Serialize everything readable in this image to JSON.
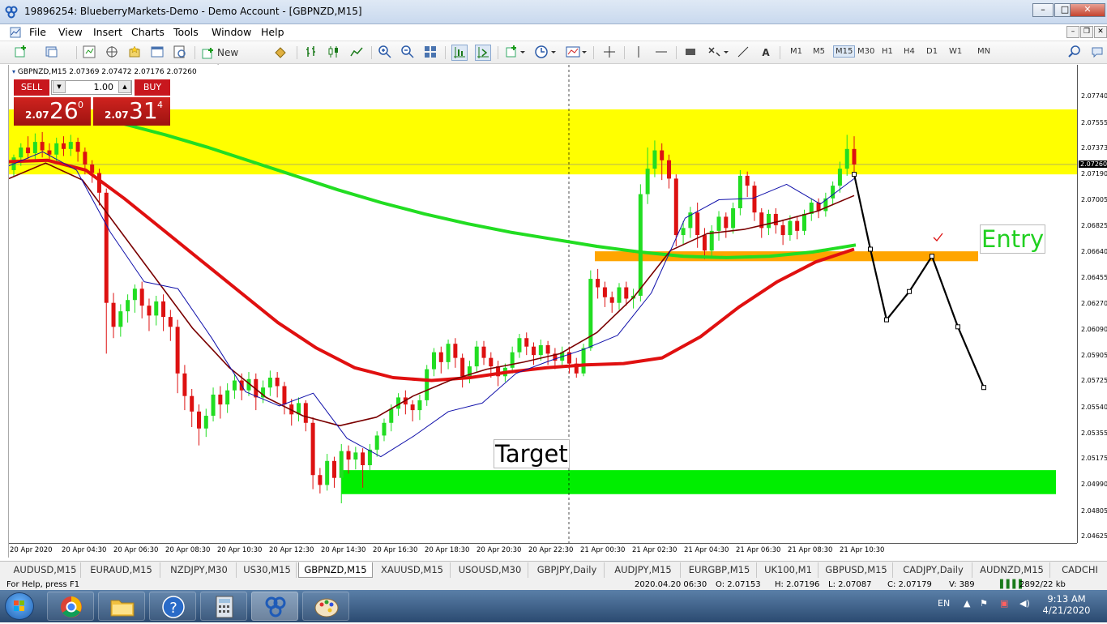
{
  "window": {
    "title": "19896254: BlueberryMarkets-Demo - Demo Account - [GBPNZD,M15]",
    "controls": [
      "–",
      "□",
      "✕"
    ]
  },
  "menu": [
    "File",
    "View",
    "Insert",
    "Charts",
    "Tools",
    "Window",
    "Help"
  ],
  "toolbar": {
    "new_order": "New Order",
    "timeframes": [
      "M1",
      "M5",
      "M15",
      "M30",
      "H1",
      "H4",
      "D1",
      "W1",
      "MN"
    ],
    "active_timeframe": "M15"
  },
  "chart": {
    "header": "GBPNZD,M15  2.07369 2.07472 2.07176 2.07260",
    "one_click": {
      "sell": "SELL",
      "buy": "BUY",
      "lot": "1.00",
      "bid_prefix": "2.07",
      "bid_big": "26",
      "bid_sup": "0",
      "ask_prefix": "2.07",
      "ask_big": "31",
      "ask_sup": "4"
    },
    "price_labels": [
      "2.07740",
      "2.07555",
      "2.07373",
      "2.07190",
      "2.07005",
      "2.06825",
      "2.06640",
      "2.06455",
      "2.06270",
      "2.06090",
      "2.05905",
      "2.05725",
      "2.05540",
      "2.05355",
      "2.05175",
      "2.04990",
      "2.04805",
      "2.04625"
    ],
    "current_price": "2.07260",
    "time_labels": [
      "20 Apr 2020",
      "20 Apr 04:30",
      "20 Apr 06:30",
      "20 Apr 08:30",
      "20 Apr 10:30",
      "20 Apr 12:30",
      "20 Apr 14:30",
      "20 Apr 16:30",
      "20 Apr 18:30",
      "20 Apr 20:30",
      "20 Apr 22:30",
      "21 Apr 00:30",
      "21 Apr 02:30",
      "21 Apr 04:30",
      "21 Apr 06:30",
      "21 Apr 08:30",
      "21 Apr 10:30"
    ],
    "target_label": "Target",
    "entry_label": "Entry",
    "colors": {
      "resistance_zone": "#ffff00",
      "target_zone": "#00ee00",
      "entry_zone": "#ffa500",
      "bull": "#22dd22",
      "bear": "#dd1111",
      "ma_slow": "#22dd22",
      "ma_mid": "#e01010",
      "ma_fast": "#7a0000",
      "ma_fastest": "#1010aa"
    },
    "chart_data": {
      "type": "candlestick",
      "symbol": "GBPNZD",
      "timeframe": "M15",
      "ylim": [
        2.04625,
        2.0792
      ],
      "open": 2.07369,
      "high": 2.07472,
      "low": 2.07176,
      "close": 2.0726,
      "zones": [
        {
          "name": "resistance",
          "from": 2.0719,
          "to": 2.0765
        },
        {
          "name": "target",
          "from": 2.04925,
          "to": 2.05095
        },
        {
          "name": "entry",
          "from": 2.06575,
          "to": 2.06645
        }
      ],
      "ma_slow": [
        2.0755,
        2.0747,
        2.0738,
        2.0728,
        2.0718,
        2.0708,
        2.0699,
        2.0691,
        2.0684,
        2.0678,
        2.0673,
        2.0668,
        2.0664,
        2.0661,
        2.066,
        2.0661,
        2.0664,
        2.0669
      ],
      "ma_mid": [
        2.0728,
        2.0729,
        2.0722,
        2.0702,
        2.068,
        2.0658,
        2.0636,
        2.0614,
        2.0596,
        2.0582,
        2.0575,
        2.0573,
        2.0575,
        2.0579,
        2.0582,
        2.0584,
        2.0585,
        2.0589,
        2.0604,
        2.0625,
        2.0643,
        2.0657,
        2.0666
      ],
      "ma_fast": [
        2.0716,
        2.0727,
        2.0715,
        2.068,
        2.0645,
        2.061,
        2.0582,
        2.0561,
        2.0548,
        2.0541,
        2.0547,
        2.0562,
        2.0573,
        2.0581,
        2.0586,
        2.0592,
        2.0607,
        2.0632,
        2.0665,
        2.0677,
        2.068,
        2.0686,
        2.0693,
        2.0704
      ],
      "ma_fastest": [
        2.0725,
        2.0735,
        2.0722,
        2.0678,
        2.0643,
        2.0638,
        2.0603,
        2.0565,
        2.0555,
        2.0564,
        2.0532,
        2.0519,
        2.0534,
        2.0551,
        2.0557,
        2.0578,
        2.0587,
        2.0595,
        2.0605,
        2.0635,
        2.0688,
        2.0701,
        2.0702,
        2.0712,
        2.0698,
        2.0716
      ],
      "forecast": [
        2.0719,
        2.0666,
        2.0616,
        2.0636,
        2.0661,
        2.0611,
        2.0568
      ],
      "candles": [
        [
          2.0722,
          2.0731,
          2.0717,
          2.0733
        ],
        [
          2.0731,
          2.0738,
          2.0725,
          2.0741
        ],
        [
          2.0738,
          2.0734,
          2.073,
          2.0746
        ],
        [
          2.0734,
          2.0742,
          2.0729,
          2.0748
        ],
        [
          2.0742,
          2.0736,
          2.0731,
          2.0749
        ],
        [
          2.0736,
          2.0733,
          2.0728,
          2.0741
        ],
        [
          2.0733,
          2.0741,
          2.0728,
          2.0745
        ],
        [
          2.0741,
          2.0737,
          2.0732,
          2.0746
        ],
        [
          2.0737,
          2.0742,
          2.0732,
          2.0747
        ],
        [
          2.0742,
          2.0735,
          2.0728,
          2.0745
        ],
        [
          2.0735,
          2.0726,
          2.0719,
          2.0738
        ],
        [
          2.0726,
          2.072,
          2.0713,
          2.0729
        ],
        [
          2.072,
          2.0706,
          2.0697,
          2.0723
        ],
        [
          2.0706,
          2.0628,
          2.0592,
          2.0709
        ],
        [
          2.0628,
          2.0611,
          2.0603,
          2.0635
        ],
        [
          2.0611,
          2.0622,
          2.0604,
          2.0627
        ],
        [
          2.0622,
          2.063,
          2.0614,
          2.0634
        ],
        [
          2.063,
          2.0638,
          2.0621,
          2.0641
        ],
        [
          2.0638,
          2.0626,
          2.0617,
          2.0643
        ],
        [
          2.0626,
          2.0619,
          2.0608,
          2.0631
        ],
        [
          2.0619,
          2.0629,
          2.0612,
          2.0633
        ],
        [
          2.0629,
          2.0618,
          2.0608,
          2.0634
        ],
        [
          2.0618,
          2.0611,
          2.0601,
          2.0623
        ],
        [
          2.0611,
          2.0578,
          2.0564,
          2.0616
        ],
        [
          2.0578,
          2.0562,
          2.0552,
          2.0584
        ],
        [
          2.0562,
          2.0551,
          2.054,
          2.0567
        ],
        [
          2.0551,
          2.0539,
          2.0527,
          2.0556
        ],
        [
          2.0539,
          2.0548,
          2.0533,
          2.0553
        ],
        [
          2.0548,
          2.0563,
          2.0544,
          2.0568
        ],
        [
          2.0563,
          2.0556,
          2.0546,
          2.0569
        ],
        [
          2.0556,
          2.0566,
          2.055,
          2.0571
        ],
        [
          2.0566,
          2.0573,
          2.056,
          2.0578
        ],
        [
          2.0573,
          2.0566,
          2.0559,
          2.0578
        ],
        [
          2.0566,
          2.0574,
          2.0562,
          2.0579
        ],
        [
          2.0574,
          2.0561,
          2.0552,
          2.0578
        ],
        [
          2.0561,
          2.0568,
          2.0557,
          2.0573
        ],
        [
          2.0568,
          2.0575,
          2.0562,
          2.058
        ],
        [
          2.0575,
          2.0569,
          2.0561,
          2.0579
        ],
        [
          2.0569,
          2.0556,
          2.0549,
          2.0572
        ],
        [
          2.0556,
          2.0549,
          2.0541,
          2.056
        ],
        [
          2.0549,
          2.0557,
          2.0544,
          2.0561
        ],
        [
          2.0557,
          2.0543,
          2.0537,
          2.0559
        ],
        [
          2.0543,
          2.0506,
          2.0496,
          2.0547
        ],
        [
          2.0506,
          2.0499,
          2.0493,
          2.0511
        ],
        [
          2.0499,
          2.0516,
          2.0495,
          2.0521
        ],
        [
          2.0516,
          2.0504,
          2.0497,
          2.0519
        ],
        [
          2.0504,
          2.0523,
          2.0486,
          2.0528
        ],
        [
          2.0523,
          2.0517,
          2.0507,
          2.0527
        ],
        [
          2.0517,
          2.0522,
          2.051,
          2.0526
        ],
        [
          2.0522,
          2.0513,
          2.0497,
          2.0525
        ],
        [
          2.0513,
          2.0524,
          2.0509,
          2.0528
        ],
        [
          2.0524,
          2.0534,
          2.0519,
          2.0537
        ],
        [
          2.0534,
          2.0543,
          2.053,
          2.0546
        ],
        [
          2.0543,
          2.0553,
          2.0537,
          2.0556
        ],
        [
          2.0553,
          2.0561,
          2.0548,
          2.0564
        ],
        [
          2.0561,
          2.0556,
          2.0549,
          2.0566
        ],
        [
          2.0556,
          2.0552,
          2.0544,
          2.0559
        ],
        [
          2.0552,
          2.0559,
          2.0545,
          2.0563
        ],
        [
          2.0559,
          2.0581,
          2.0555,
          2.0584
        ],
        [
          2.0581,
          2.0593,
          2.0576,
          2.0596
        ],
        [
          2.0593,
          2.0586,
          2.0578,
          2.0597
        ],
        [
          2.0586,
          2.0599,
          2.0581,
          2.0602
        ],
        [
          2.0599,
          2.0589,
          2.0582,
          2.0603
        ],
        [
          2.0589,
          2.0576,
          2.0568,
          2.0592
        ],
        [
          2.0576,
          2.0583,
          2.0571,
          2.0587
        ],
        [
          2.0583,
          2.0597,
          2.0579,
          2.0601
        ],
        [
          2.0597,
          2.0589,
          2.0584,
          2.0601
        ],
        [
          2.0589,
          2.0583,
          2.0575,
          2.0593
        ],
        [
          2.0583,
          2.0576,
          2.0569,
          2.0587
        ],
        [
          2.0576,
          2.0582,
          2.0572,
          2.0585
        ],
        [
          2.0582,
          2.0593,
          2.0578,
          2.0597
        ],
        [
          2.0593,
          2.0603,
          2.0589,
          2.0606
        ],
        [
          2.0603,
          2.0597,
          2.0591,
          2.0607
        ],
        [
          2.0597,
          2.0591,
          2.0584,
          2.06
        ],
        [
          2.0591,
          2.0598,
          2.0587,
          2.0602
        ],
        [
          2.0598,
          2.0592,
          2.0584,
          2.0601
        ],
        [
          2.0592,
          2.0587,
          2.0581,
          2.0596
        ],
        [
          2.0587,
          2.0593,
          2.0582,
          2.0597
        ],
        [
          2.0593,
          2.0585,
          2.0578,
          2.0597
        ],
        [
          2.0585,
          2.0578,
          2.0575,
          2.0589
        ],
        [
          2.0578,
          2.0596,
          2.0576,
          2.0599
        ],
        [
          2.0596,
          2.0645,
          2.0594,
          2.0651
        ],
        [
          2.0645,
          2.0639,
          2.0631,
          2.0652
        ],
        [
          2.0639,
          2.0632,
          2.0625,
          2.0643
        ],
        [
          2.0632,
          2.0628,
          2.0621,
          2.0636
        ],
        [
          2.0628,
          2.0639,
          2.0623,
          2.0642
        ],
        [
          2.0639,
          2.0631,
          2.0626,
          2.0643
        ],
        [
          2.0631,
          2.0633,
          2.0624,
          2.0638
        ],
        [
          2.0633,
          2.0705,
          2.0629,
          2.0712
        ],
        [
          2.0705,
          2.0723,
          2.0698,
          2.0738
        ],
        [
          2.0723,
          2.0736,
          2.0717,
          2.0743
        ],
        [
          2.0736,
          2.0729,
          2.0715,
          2.0741
        ],
        [
          2.0729,
          2.0716,
          2.0709,
          2.0733
        ],
        [
          2.0716,
          2.0676,
          2.0668,
          2.0719
        ],
        [
          2.0676,
          2.0681,
          2.0669,
          2.0686
        ],
        [
          2.0681,
          2.0692,
          2.0674,
          2.0696
        ],
        [
          2.0692,
          2.0676,
          2.0667,
          2.0699
        ],
        [
          2.0676,
          2.0665,
          2.0659,
          2.0681
        ],
        [
          2.0665,
          2.0679,
          2.0661,
          2.0683
        ],
        [
          2.0679,
          2.0689,
          2.0672,
          2.0693
        ],
        [
          2.0689,
          2.0681,
          2.0674,
          2.0692
        ],
        [
          2.0681,
          2.0695,
          2.0677,
          2.0699
        ],
        [
          2.0695,
          2.0718,
          2.069,
          2.0722
        ],
        [
          2.0718,
          2.0711,
          2.0703,
          2.0721
        ],
        [
          2.0711,
          2.0692,
          2.0686,
          2.0714
        ],
        [
          2.0692,
          2.0681,
          2.0674,
          2.0695
        ],
        [
          2.0681,
          2.0691,
          2.0676,
          2.0694
        ],
        [
          2.0691,
          2.0683,
          2.0677,
          2.0695
        ],
        [
          2.0683,
          2.0676,
          2.0669,
          2.0687
        ],
        [
          2.0676,
          2.0686,
          2.0672,
          2.069
        ],
        [
          2.0686,
          2.0679,
          2.0673,
          2.0689
        ],
        [
          2.0679,
          2.0691,
          2.0676,
          2.0694
        ],
        [
          2.0691,
          2.0699,
          2.0686,
          2.0702
        ],
        [
          2.0699,
          2.0693,
          2.0688,
          2.0702
        ],
        [
          2.0693,
          2.0702,
          2.0689,
          2.0706
        ],
        [
          2.0702,
          2.0711,
          2.0697,
          2.0714
        ],
        [
          2.0711,
          2.0723,
          2.0706,
          2.0728
        ],
        [
          2.0723,
          2.0737,
          2.0718,
          2.0747
        ],
        [
          2.0737,
          2.0726,
          2.0717,
          2.0746
        ]
      ]
    }
  },
  "tabs": [
    "AUDUSD,M15",
    "EURAUD,M15",
    "NZDJPY,M30",
    "US30,M15",
    "GBPNZD,M15",
    "XAUUSD,M15",
    "USOUSD,M30",
    "GBPJPY,Daily",
    "AUDJPY,M15",
    "EURGBP,M15",
    "UK100,M1",
    "GBPUSD,M15",
    "CADJPY,Daily",
    "AUDNZD,M15",
    "CADCHI"
  ],
  "active_tab": "GBPNZD,M15",
  "status": {
    "help": "For Help, press F1",
    "datetime": "2020.04.20 06:30",
    "open": "O: 2.07153",
    "high": "H: 2.07196",
    "low": "L: 2.07087",
    "close": "C: 2.07179",
    "volume": "V: 389",
    "traffic": "2892/22 kb"
  },
  "taskbar": {
    "lang": "EN",
    "time": "9:13 AM",
    "date": "4/21/2020"
  }
}
